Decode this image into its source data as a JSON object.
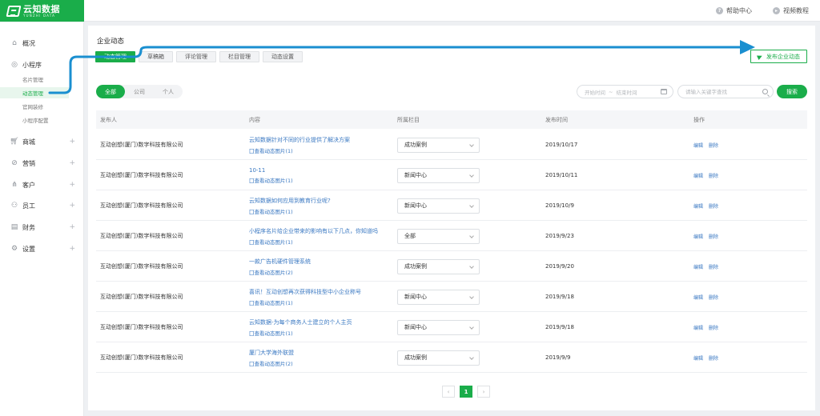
{
  "logo": {
    "name": "云知数据",
    "sub": "YUNZHI DATA"
  },
  "top_links": [
    {
      "label": "帮助中心",
      "icon": "help-icon"
    },
    {
      "label": "视频教程",
      "icon": "video-icon"
    }
  ],
  "sidebar": {
    "items": [
      {
        "label": "概况",
        "icon": "home-icon"
      },
      {
        "label": "小程序",
        "icon": "mini-program-icon"
      },
      {
        "label": "商城",
        "icon": "cart-icon"
      },
      {
        "label": "营销",
        "icon": "marketing-icon"
      },
      {
        "label": "客户",
        "icon": "customer-icon"
      },
      {
        "label": "员工",
        "icon": "staff-icon"
      },
      {
        "label": "财务",
        "icon": "finance-icon"
      },
      {
        "label": "设置",
        "icon": "settings-icon"
      }
    ],
    "sub_items": [
      {
        "label": "名片管理"
      },
      {
        "label": "动态管理",
        "active": true
      },
      {
        "label": "官网装修"
      },
      {
        "label": "小程序配置"
      }
    ]
  },
  "main": {
    "title": "企业动态",
    "tabs": [
      "动态管理",
      "草稿箱",
      "评论管理",
      "栏目管理",
      "动态设置"
    ],
    "publish_label": "发布企业动态",
    "filters": [
      "全部",
      "公司",
      "个人"
    ],
    "date_start": "开始时间",
    "date_sep": "~",
    "date_end": "结束时间",
    "search_placeholder": "请输入关键字查找",
    "search_label": "搜索",
    "columns": [
      "发布人",
      "内容",
      "所属栏目",
      "发布时间",
      "操作"
    ],
    "op_edit": "编辑",
    "op_delete": "删除",
    "rows": [
      {
        "publisher": "互动创想(厦门)数字科技有限公司",
        "title": "云知数据针对不同的行业提供了解决方案",
        "images": "囗查看动态图片(1)",
        "category": "成功案例",
        "date": "2019/10/17"
      },
      {
        "publisher": "互动创想(厦门)数字科技有限公司",
        "title": "10-11",
        "images": "囗查看动态图片(1)",
        "category": "新闻中心",
        "date": "2019/10/11"
      },
      {
        "publisher": "互动创想(厦门)数字科技有限公司",
        "title": "云知数据如何应用到教育行业呢?",
        "images": "囗查看动态图片(1)",
        "category": "新闻中心",
        "date": "2019/10/9"
      },
      {
        "publisher": "互动创想(厦门)数字科技有限公司",
        "title": "小程序名片给企业带来的影响有以下几点，你知道吗",
        "images": "囗查看动态图片(1)",
        "category": "全部",
        "date": "2019/9/23"
      },
      {
        "publisher": "互动创想(厦门)数字科技有限公司",
        "title": "一款广告机硬件管理系统",
        "images": "囗查看动态图片(2)",
        "category": "成功案例",
        "date": "2019/9/20"
      },
      {
        "publisher": "互动创想(厦门)数字科技有限公司",
        "title": "喜讯！互动创想再次获得科技型中小企业称号",
        "images": "囗查看动态图片(1)",
        "category": "新闻中心",
        "date": "2019/9/18"
      },
      {
        "publisher": "互动创想(厦门)数字科技有限公司",
        "title": "云知数据-为每个商务人士建立的个人主页",
        "images": "囗查看动态图片(1)",
        "category": "新闻中心",
        "date": "2019/9/18"
      },
      {
        "publisher": "互动创想(厦门)数字科技有限公司",
        "title": "厦门大学海外联盟",
        "images": "囗查看动态图片(2)",
        "category": "成功案例",
        "date": "2019/9/9"
      }
    ],
    "pager": {
      "prev": "‹",
      "current": "1",
      "next": "›"
    }
  },
  "colors": {
    "brand": "#1aad4a",
    "link": "#3a78c2",
    "annotation": "#1a8fd0"
  }
}
